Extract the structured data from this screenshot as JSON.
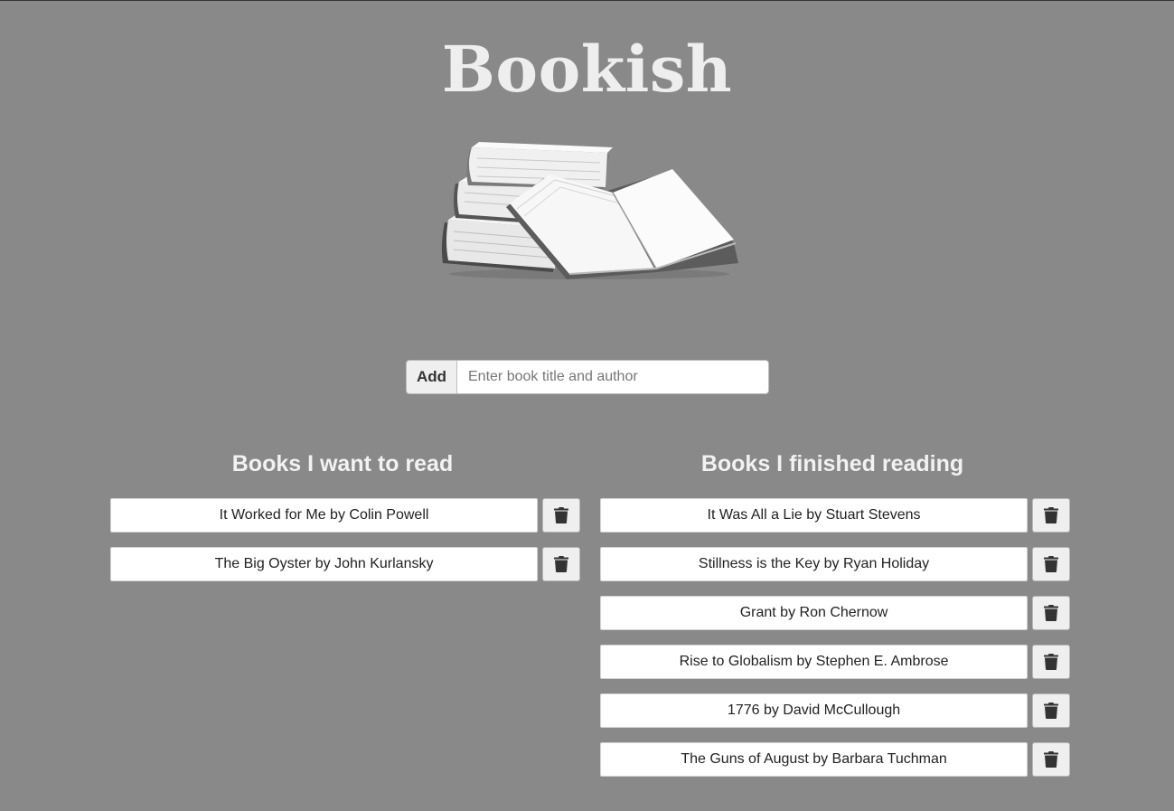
{
  "app": {
    "title": "Bookish"
  },
  "add_bar": {
    "button_label": "Add",
    "input_placeholder": "Enter book title and author",
    "input_value": ""
  },
  "want_to_read": {
    "heading": "Books I want to read",
    "items": [
      "It Worked for Me by Colin Powell",
      "The Big Oyster by John Kurlansky"
    ]
  },
  "finished_reading": {
    "heading": "Books I finished reading",
    "items": [
      "It Was All a Lie by Stuart Stevens",
      "Stillness is the Key by Ryan Holiday",
      "Grant by Ron Chernow",
      "Rise to Globalism by Stephen E. Ambrose",
      "1776 by David McCullough",
      "The Guns of August by Barbara Tuchman"
    ]
  },
  "icons": {
    "delete": "trash-icon",
    "illustration": "books-stack-icon"
  },
  "colors": {
    "background": "#898989",
    "heading_text": "#f2f2f2",
    "title_text": "#eeeeee"
  }
}
